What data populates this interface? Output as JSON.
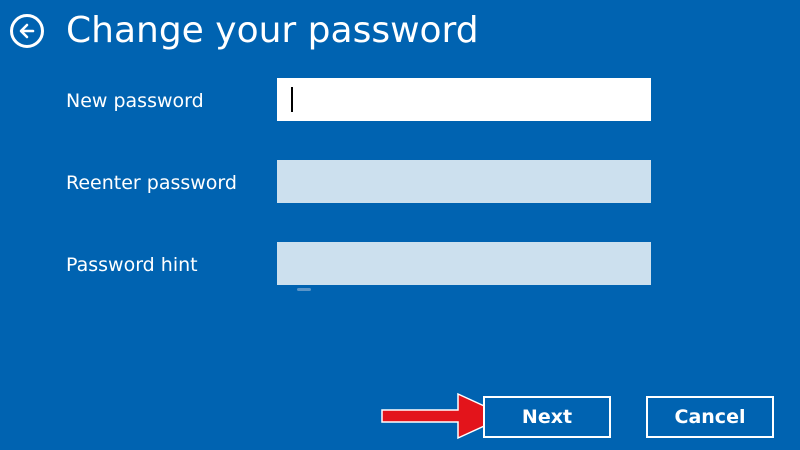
{
  "header": {
    "back_icon": "back-arrow-icon",
    "title": "Change your password"
  },
  "form": {
    "new_password": {
      "label": "New password",
      "value": ""
    },
    "reenter_password": {
      "label": "Reenter password",
      "value": ""
    },
    "password_hint": {
      "label": "Password hint",
      "value": ""
    }
  },
  "buttons": {
    "next": "Next",
    "cancel": "Cancel"
  },
  "annotation": {
    "icon": "red-arrow-icon",
    "color": "#e3141b"
  },
  "colors": {
    "background": "#0063b1",
    "input_active": "#ffffff",
    "input_inactive": "#cce0ee",
    "text": "#ffffff"
  }
}
